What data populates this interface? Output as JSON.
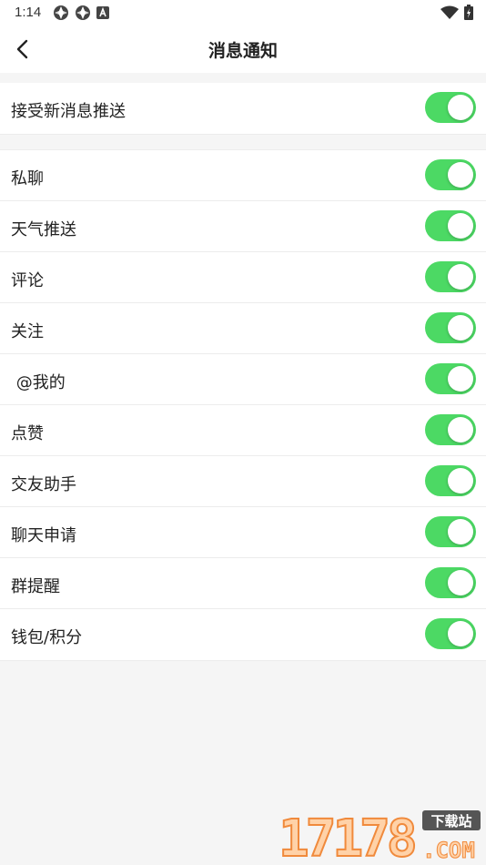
{
  "status_bar": {
    "time": "1:14",
    "left_icons": [
      "app-notification-icon",
      "app-notification-icon",
      "accessibility-icon"
    ],
    "right_icons": [
      "wifi-icon",
      "battery-icon"
    ]
  },
  "header": {
    "title": "消息通知",
    "back_icon": "back-arrow-icon"
  },
  "master_setting": {
    "label": "接受新消息推送",
    "enabled": true
  },
  "settings": [
    {
      "label": "私聊",
      "enabled": true
    },
    {
      "label": "天气推送",
      "enabled": true
    },
    {
      "label": "评论",
      "enabled": true
    },
    {
      "label": "关注",
      "enabled": true
    },
    {
      "label": " @我的",
      "enabled": true
    },
    {
      "label": "点赞",
      "enabled": true
    },
    {
      "label": "交友助手",
      "enabled": true
    },
    {
      "label": "聊天申请",
      "enabled": true
    },
    {
      "label": "群提醒",
      "enabled": true
    },
    {
      "label": "钱包/积分",
      "enabled": true
    }
  ],
  "watermark": {
    "number": "17178",
    "badge": "下载站",
    "domain": ".COM"
  },
  "colors": {
    "toggle_on": "#4cd964",
    "background": "#f5f5f5",
    "surface": "#ffffff",
    "text": "#222222",
    "watermark_accent": "#f08a3c"
  }
}
